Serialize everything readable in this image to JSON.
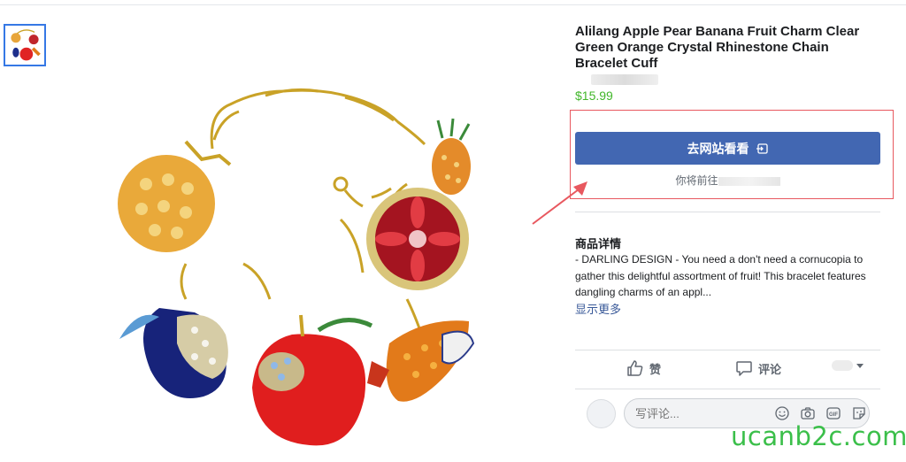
{
  "product": {
    "title": "Alilang Apple Pear Banana Fruit Charm Clear Green Orange Crystal Rhinestone Chain Bracelet Cuff",
    "price": "$15.99"
  },
  "cta": {
    "label": "去网站看看",
    "icon": "external-link-icon",
    "leave_note": "你将前往"
  },
  "details": {
    "heading": "商品详情",
    "text": "- DARLING DESIGN - You need a don't need a cornucopia to gather this delightful assortment of fruit! This bracelet features dangling charms of an appl...",
    "see_more": "显示更多"
  },
  "actions": {
    "like_label": "赞",
    "comment_label": "评论"
  },
  "comment_box": {
    "placeholder": "写评论..."
  },
  "watermark": "ucanb2c.com",
  "colors": {
    "cta_blue": "#4267b2",
    "price_green": "#42b72a",
    "annotation_red": "#e8585f",
    "link_blue": "#385898",
    "watermark_green": "#3bbf4a"
  }
}
